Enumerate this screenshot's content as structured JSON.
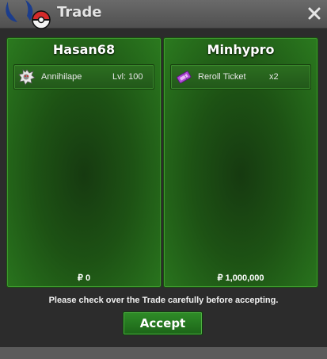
{
  "window": {
    "title": "Trade",
    "close_icon": "close-icon"
  },
  "left_panel": {
    "player_name": "Hasan68",
    "item": {
      "icon": "pokemon-icon",
      "name": "Annihilape",
      "level": "Lvl: 100"
    },
    "money": "₽ 0"
  },
  "right_panel": {
    "player_name": "Minhypro",
    "item": {
      "icon": "ticket-icon",
      "name": "Reroll Ticket",
      "quantity": "x2"
    },
    "money": "₽ 1,000,000"
  },
  "notice": "Please check over the Trade carefully before accepting.",
  "accept_label": "Accept",
  "colors": {
    "panel_green": "#1d5214",
    "button_green": "#2f8c28",
    "titlebar": "#5c5c5c"
  }
}
